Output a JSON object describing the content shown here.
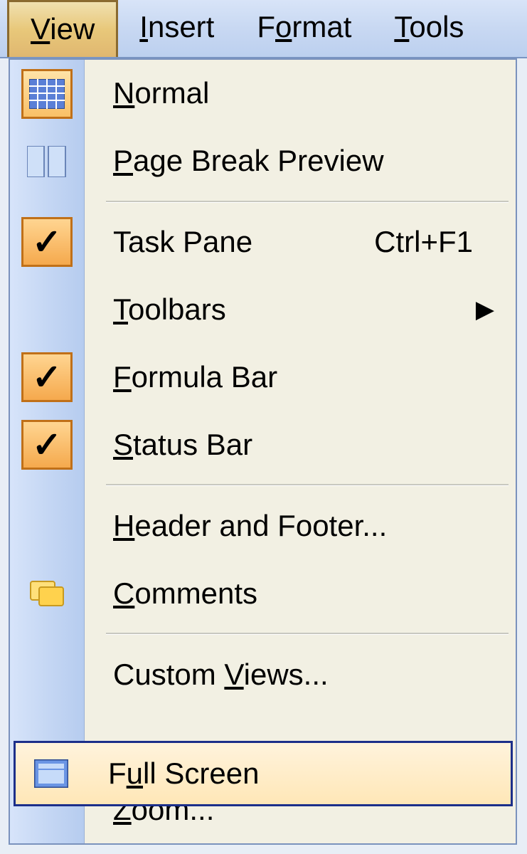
{
  "menubar": {
    "view": "View",
    "view_accel": "V",
    "insert": "Insert",
    "insert_accel": "I",
    "format": "Format",
    "format_accel": "o",
    "tools": "Tools",
    "tools_accel": "T"
  },
  "menu": {
    "normal": "Normal",
    "normal_accel": "N",
    "page_break": "Page Break Preview",
    "page_break_accel": "P",
    "task_pane": "Task Pane",
    "task_shortcut": "Ctrl+F1",
    "toolbars": "Toolbars",
    "toolbars_accel": "T",
    "formula_bar": "Formula Bar",
    "formula_accel": "F",
    "status_bar": "Status Bar",
    "status_accel": "S",
    "header_footer": "Header and Footer...",
    "header_accel": "H",
    "comments": "Comments",
    "comments_accel": "C",
    "custom_views": "Custom Views...",
    "custom_accel": "V",
    "full_screen": "Full Screen",
    "full_accel": "u",
    "zoom": "Zoom...",
    "zoom_accel": "Z"
  }
}
